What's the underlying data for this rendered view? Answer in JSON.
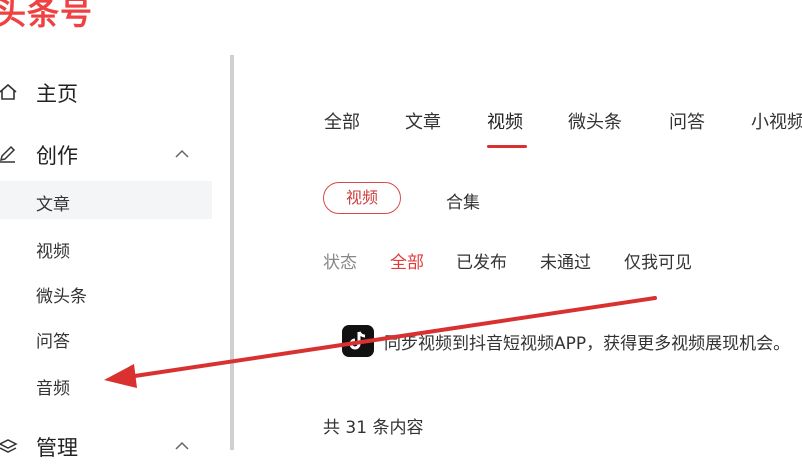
{
  "brand": {
    "logo_text": "头条号"
  },
  "sidebar": {
    "home": "主页",
    "create": "创作",
    "create_items": [
      "文章",
      "视频",
      "微头条",
      "问答",
      "音频"
    ],
    "manage": "管理"
  },
  "tabs": [
    "全部",
    "文章",
    "视频",
    "微头条",
    "问答",
    "小视频"
  ],
  "active_tab": "视频",
  "subtabs": {
    "video": "视频",
    "collection": "合集"
  },
  "filter": {
    "label": "状态",
    "options": [
      "全部",
      "已发布",
      "未通过",
      "仅我可见"
    ],
    "active": "全部"
  },
  "notice": {
    "text": "同步视频到抖音短视频APP，获得更多视频展现机会。",
    "icon": "douyin-icon"
  },
  "count_text": "共 31 条内容",
  "colors": {
    "accent": "#e03a3a",
    "arrow": "#d93030",
    "sidebar_divider": "#d0d0d0"
  }
}
